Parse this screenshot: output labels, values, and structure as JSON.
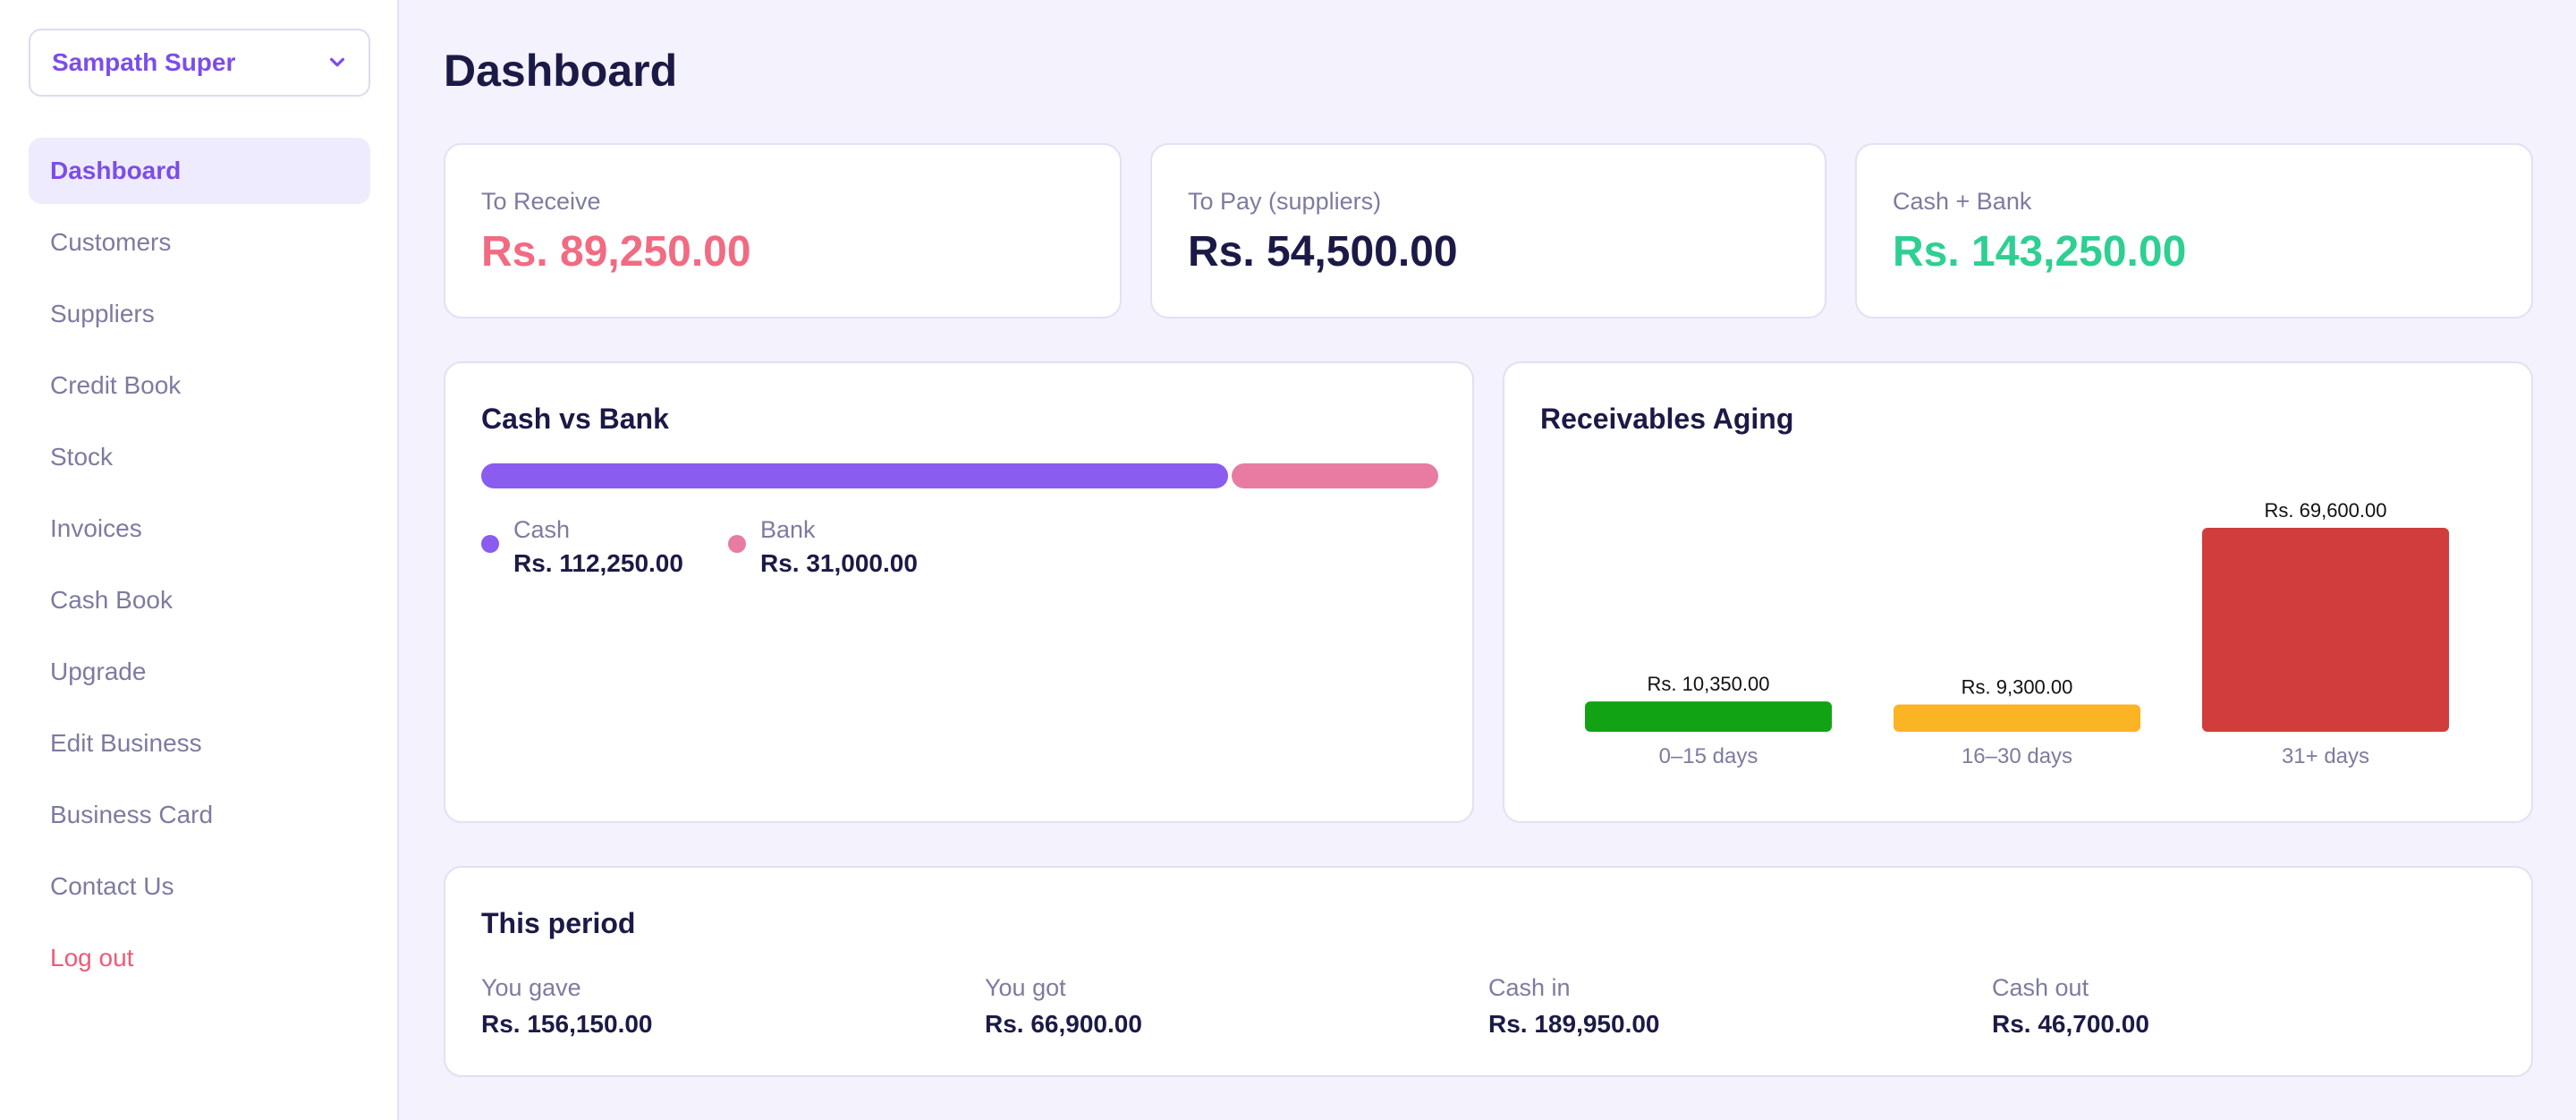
{
  "business": {
    "name": "Sampath Super"
  },
  "nav": [
    {
      "label": "Dashboard",
      "state": "active"
    },
    {
      "label": "Customers"
    },
    {
      "label": "Suppliers"
    },
    {
      "label": "Credit Book"
    },
    {
      "label": "Stock"
    },
    {
      "label": "Invoices"
    },
    {
      "label": "Cash Book"
    },
    {
      "label": "Upgrade"
    },
    {
      "label": "Edit Business"
    },
    {
      "label": "Business Card"
    },
    {
      "label": "Contact Us"
    },
    {
      "label": "Log out",
      "state": "danger"
    }
  ],
  "page": {
    "title": "Dashboard"
  },
  "kpis": [
    {
      "label": "To Receive",
      "value": "Rs. 89,250.00",
      "color": "#f16b82"
    },
    {
      "label": "To Pay (suppliers)",
      "value": "Rs. 54,500.00",
      "color": "#1b1a47"
    },
    {
      "label": "Cash + Bank",
      "value": "Rs. 143,250.00",
      "color": "#2fcf92"
    }
  ],
  "cash_vs_bank": {
    "title": "Cash vs Bank",
    "items": [
      {
        "label": "Cash",
        "value": "Rs. 112,250.00",
        "amount": 112250,
        "color": "#8a5cf0"
      },
      {
        "label": "Bank",
        "value": "Rs. 31,000.00",
        "amount": 31000,
        "color": "#e87ba2"
      }
    ]
  },
  "chart_data": {
    "type": "bar",
    "title": "Receivables Aging",
    "categories": [
      "0–15 days",
      "16–30 days",
      "31+ days"
    ],
    "values": [
      10350,
      9300,
      69600
    ],
    "value_labels": [
      "Rs. 10,350.00",
      "Rs. 9,300.00",
      "Rs. 69,600.00"
    ],
    "colors": [
      "#12a314",
      "#fbb424",
      "#d13c3c"
    ],
    "xlabel": "",
    "ylabel": "",
    "ylim": [
      0,
      69600
    ],
    "grid": false
  },
  "period": {
    "title": "This period",
    "items": [
      {
        "label": "You gave",
        "value": "Rs. 156,150.00"
      },
      {
        "label": "You got",
        "value": "Rs. 66,900.00"
      },
      {
        "label": "Cash in",
        "value": "Rs. 189,950.00"
      },
      {
        "label": "Cash out",
        "value": "Rs. 46,700.00"
      }
    ]
  },
  "icons": {
    "business_select": "chevron-down-icon"
  }
}
